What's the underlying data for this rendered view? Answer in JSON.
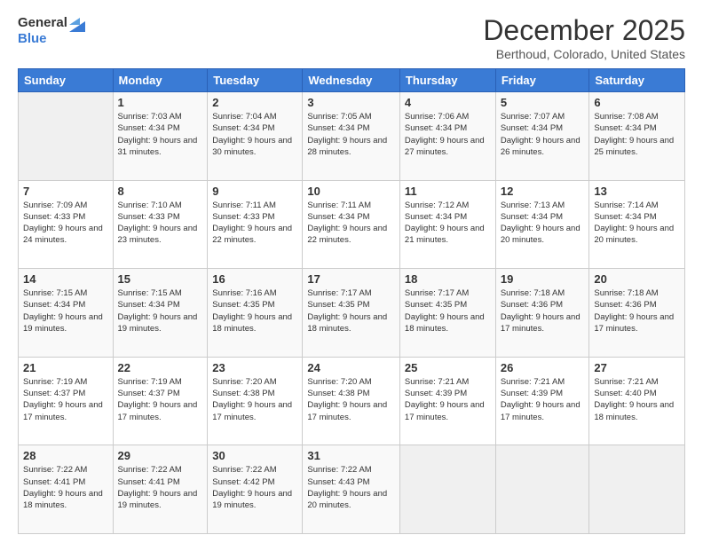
{
  "logo": {
    "general": "General",
    "blue": "Blue"
  },
  "title": "December 2025",
  "location": "Berthoud, Colorado, United States",
  "headers": [
    "Sunday",
    "Monday",
    "Tuesday",
    "Wednesday",
    "Thursday",
    "Friday",
    "Saturday"
  ],
  "weeks": [
    [
      {
        "day": "",
        "empty": true
      },
      {
        "day": "1",
        "sunrise": "Sunrise: 7:03 AM",
        "sunset": "Sunset: 4:34 PM",
        "daylight": "Daylight: 9 hours and 31 minutes."
      },
      {
        "day": "2",
        "sunrise": "Sunrise: 7:04 AM",
        "sunset": "Sunset: 4:34 PM",
        "daylight": "Daylight: 9 hours and 30 minutes."
      },
      {
        "day": "3",
        "sunrise": "Sunrise: 7:05 AM",
        "sunset": "Sunset: 4:34 PM",
        "daylight": "Daylight: 9 hours and 28 minutes."
      },
      {
        "day": "4",
        "sunrise": "Sunrise: 7:06 AM",
        "sunset": "Sunset: 4:34 PM",
        "daylight": "Daylight: 9 hours and 27 minutes."
      },
      {
        "day": "5",
        "sunrise": "Sunrise: 7:07 AM",
        "sunset": "Sunset: 4:34 PM",
        "daylight": "Daylight: 9 hours and 26 minutes."
      },
      {
        "day": "6",
        "sunrise": "Sunrise: 7:08 AM",
        "sunset": "Sunset: 4:34 PM",
        "daylight": "Daylight: 9 hours and 25 minutes."
      }
    ],
    [
      {
        "day": "7",
        "sunrise": "Sunrise: 7:09 AM",
        "sunset": "Sunset: 4:33 PM",
        "daylight": "Daylight: 9 hours and 24 minutes."
      },
      {
        "day": "8",
        "sunrise": "Sunrise: 7:10 AM",
        "sunset": "Sunset: 4:33 PM",
        "daylight": "Daylight: 9 hours and 23 minutes."
      },
      {
        "day": "9",
        "sunrise": "Sunrise: 7:11 AM",
        "sunset": "Sunset: 4:33 PM",
        "daylight": "Daylight: 9 hours and 22 minutes."
      },
      {
        "day": "10",
        "sunrise": "Sunrise: 7:11 AM",
        "sunset": "Sunset: 4:34 PM",
        "daylight": "Daylight: 9 hours and 22 minutes."
      },
      {
        "day": "11",
        "sunrise": "Sunrise: 7:12 AM",
        "sunset": "Sunset: 4:34 PM",
        "daylight": "Daylight: 9 hours and 21 minutes."
      },
      {
        "day": "12",
        "sunrise": "Sunrise: 7:13 AM",
        "sunset": "Sunset: 4:34 PM",
        "daylight": "Daylight: 9 hours and 20 minutes."
      },
      {
        "day": "13",
        "sunrise": "Sunrise: 7:14 AM",
        "sunset": "Sunset: 4:34 PM",
        "daylight": "Daylight: 9 hours and 20 minutes."
      }
    ],
    [
      {
        "day": "14",
        "sunrise": "Sunrise: 7:15 AM",
        "sunset": "Sunset: 4:34 PM",
        "daylight": "Daylight: 9 hours and 19 minutes."
      },
      {
        "day": "15",
        "sunrise": "Sunrise: 7:15 AM",
        "sunset": "Sunset: 4:34 PM",
        "daylight": "Daylight: 9 hours and 19 minutes."
      },
      {
        "day": "16",
        "sunrise": "Sunrise: 7:16 AM",
        "sunset": "Sunset: 4:35 PM",
        "daylight": "Daylight: 9 hours and 18 minutes."
      },
      {
        "day": "17",
        "sunrise": "Sunrise: 7:17 AM",
        "sunset": "Sunset: 4:35 PM",
        "daylight": "Daylight: 9 hours and 18 minutes."
      },
      {
        "day": "18",
        "sunrise": "Sunrise: 7:17 AM",
        "sunset": "Sunset: 4:35 PM",
        "daylight": "Daylight: 9 hours and 18 minutes."
      },
      {
        "day": "19",
        "sunrise": "Sunrise: 7:18 AM",
        "sunset": "Sunset: 4:36 PM",
        "daylight": "Daylight: 9 hours and 17 minutes."
      },
      {
        "day": "20",
        "sunrise": "Sunrise: 7:18 AM",
        "sunset": "Sunset: 4:36 PM",
        "daylight": "Daylight: 9 hours and 17 minutes."
      }
    ],
    [
      {
        "day": "21",
        "sunrise": "Sunrise: 7:19 AM",
        "sunset": "Sunset: 4:37 PM",
        "daylight": "Daylight: 9 hours and 17 minutes."
      },
      {
        "day": "22",
        "sunrise": "Sunrise: 7:19 AM",
        "sunset": "Sunset: 4:37 PM",
        "daylight": "Daylight: 9 hours and 17 minutes."
      },
      {
        "day": "23",
        "sunrise": "Sunrise: 7:20 AM",
        "sunset": "Sunset: 4:38 PM",
        "daylight": "Daylight: 9 hours and 17 minutes."
      },
      {
        "day": "24",
        "sunrise": "Sunrise: 7:20 AM",
        "sunset": "Sunset: 4:38 PM",
        "daylight": "Daylight: 9 hours and 17 minutes."
      },
      {
        "day": "25",
        "sunrise": "Sunrise: 7:21 AM",
        "sunset": "Sunset: 4:39 PM",
        "daylight": "Daylight: 9 hours and 17 minutes."
      },
      {
        "day": "26",
        "sunrise": "Sunrise: 7:21 AM",
        "sunset": "Sunset: 4:39 PM",
        "daylight": "Daylight: 9 hours and 17 minutes."
      },
      {
        "day": "27",
        "sunrise": "Sunrise: 7:21 AM",
        "sunset": "Sunset: 4:40 PM",
        "daylight": "Daylight: 9 hours and 18 minutes."
      }
    ],
    [
      {
        "day": "28",
        "sunrise": "Sunrise: 7:22 AM",
        "sunset": "Sunset: 4:41 PM",
        "daylight": "Daylight: 9 hours and 18 minutes."
      },
      {
        "day": "29",
        "sunrise": "Sunrise: 7:22 AM",
        "sunset": "Sunset: 4:41 PM",
        "daylight": "Daylight: 9 hours and 19 minutes."
      },
      {
        "day": "30",
        "sunrise": "Sunrise: 7:22 AM",
        "sunset": "Sunset: 4:42 PM",
        "daylight": "Daylight: 9 hours and 19 minutes."
      },
      {
        "day": "31",
        "sunrise": "Sunrise: 7:22 AM",
        "sunset": "Sunset: 4:43 PM",
        "daylight": "Daylight: 9 hours and 20 minutes."
      },
      {
        "day": "",
        "empty": true
      },
      {
        "day": "",
        "empty": true
      },
      {
        "day": "",
        "empty": true
      }
    ]
  ]
}
